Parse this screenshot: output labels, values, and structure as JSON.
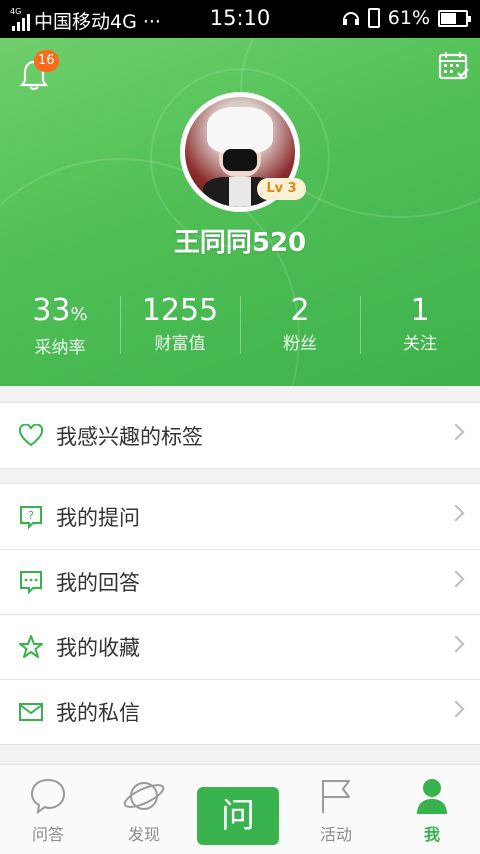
{
  "status_bar": {
    "network_type": "4G",
    "carrier": "中国移动4G ···",
    "time": "15:10",
    "battery_percent": "61%",
    "battery_level": 0.61
  },
  "header": {
    "notification_count": "16",
    "username": "王同同520",
    "level_label": "Lv 3",
    "stats": [
      {
        "value": "33",
        "unit": "%",
        "label": "采纳率"
      },
      {
        "value": "1255",
        "unit": "",
        "label": "财富值"
      },
      {
        "value": "2",
        "unit": "",
        "label": "粉丝"
      },
      {
        "value": "1",
        "unit": "",
        "label": "关注"
      }
    ]
  },
  "menu": {
    "interests": {
      "label": "我感兴趣的标签",
      "icon": "heart-icon"
    },
    "items": [
      {
        "label": "我的提问",
        "icon": "question-bubble-icon"
      },
      {
        "label": "我的回答",
        "icon": "answer-bubble-icon"
      },
      {
        "label": "我的收藏",
        "icon": "star-icon"
      },
      {
        "label": "我的私信",
        "icon": "mail-icon"
      }
    ]
  },
  "tabbar": {
    "tabs": [
      {
        "label": "问答",
        "icon": "chat-bubble-icon"
      },
      {
        "label": "发现",
        "icon": "planet-icon"
      },
      {
        "label": "问",
        "icon": "ask-button"
      },
      {
        "label": "活动",
        "icon": "flag-icon"
      },
      {
        "label": "我",
        "icon": "person-icon"
      }
    ]
  },
  "colors": {
    "accent": "#37b24d",
    "badge": "#ff6a1a",
    "level_text": "#e08a1c"
  }
}
